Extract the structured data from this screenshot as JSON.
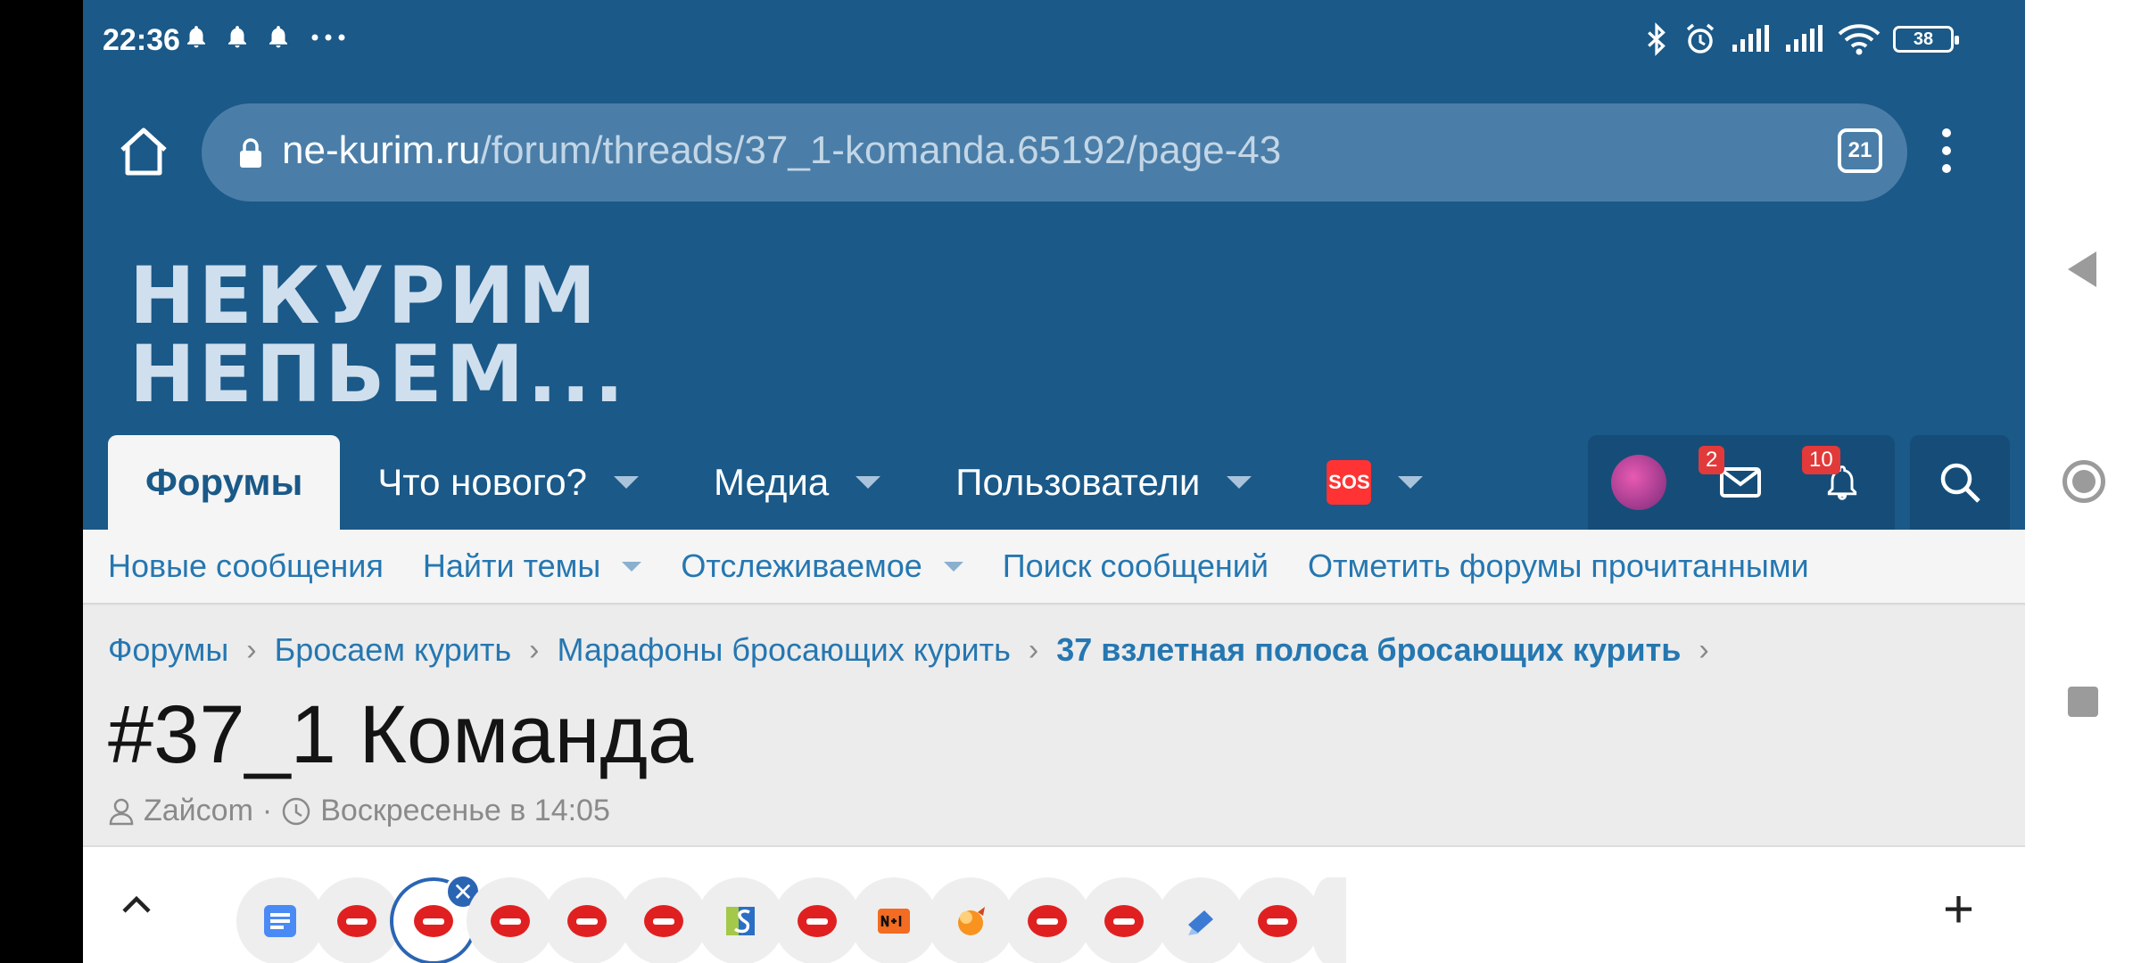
{
  "status_bar": {
    "time": "22:36",
    "battery": "38",
    "icons": [
      "bell-icon",
      "bell-icon",
      "bell-icon",
      "more-dots-icon",
      "bluetooth-icon",
      "alarm-icon",
      "signal-icon",
      "signal-icon",
      "wifi-icon",
      "battery-icon"
    ]
  },
  "browser": {
    "url_host": "ne-kurim.ru",
    "url_path": "/forum/threads/37_1-komanda.65192/page-43",
    "tab_count": "21"
  },
  "site": {
    "logo_line1": "НЕКУРИМ",
    "logo_line2": "НЕПЬЕМ...",
    "nav": [
      {
        "label": "Форумы",
        "active": true
      },
      {
        "label": "Что нового?"
      },
      {
        "label": "Медиа"
      },
      {
        "label": "Пользователи"
      },
      {
        "label": "SOS"
      }
    ],
    "messages_badge": "2",
    "alerts_badge": "10"
  },
  "subnav": [
    {
      "label": "Новые сообщения"
    },
    {
      "label": "Найти темы"
    },
    {
      "label": "Отслеживаемое"
    },
    {
      "label": "Поиск сообщений"
    },
    {
      "label": "Отметить форумы прочитанными"
    }
  ],
  "breadcrumb": [
    "Форумы",
    "Бросаем курить",
    "Марафоны бросающих курить",
    "37 взлетная полоса бросающих курить"
  ],
  "thread": {
    "title": "#37_1 Команда",
    "author": "Zaйcom",
    "date": "Воскресенье в 14:05"
  },
  "colors": {
    "header_bg": "#1a5988",
    "link": "#2577b1",
    "badge": "#e23a3a"
  }
}
